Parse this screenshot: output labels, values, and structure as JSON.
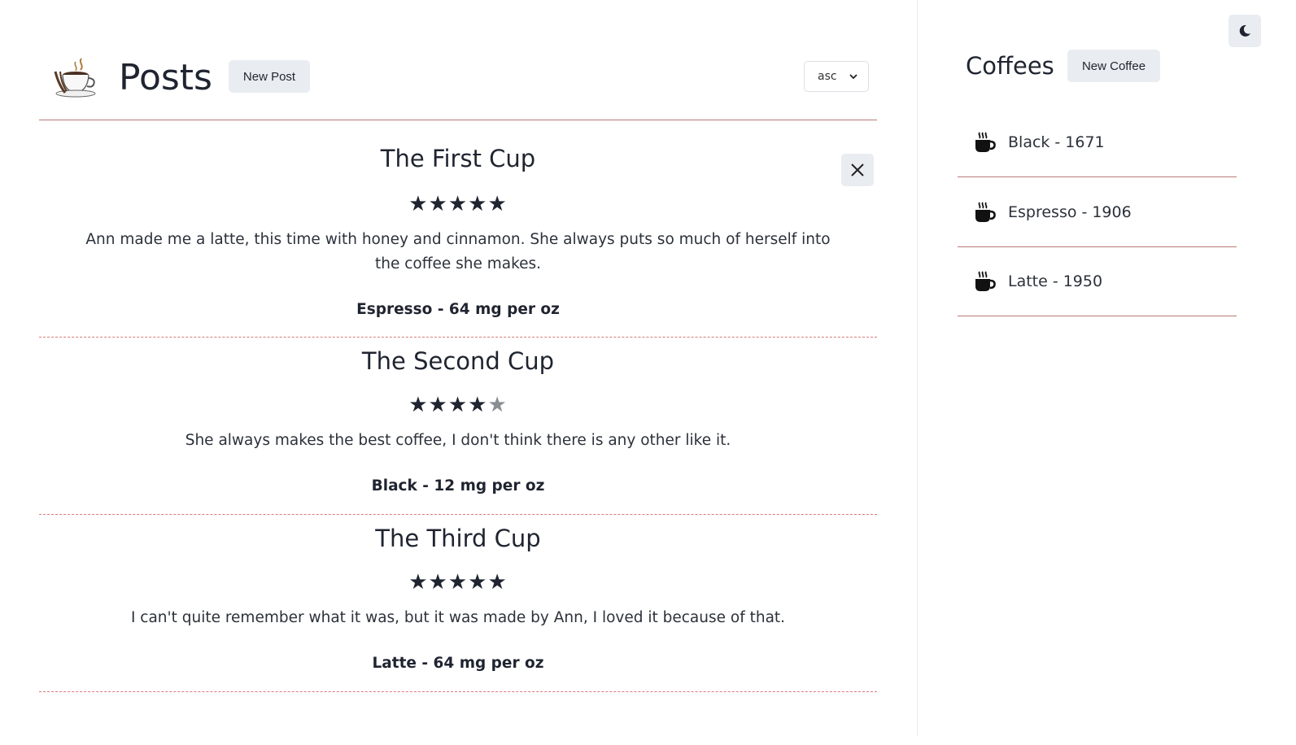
{
  "posts_panel": {
    "title": "Posts",
    "new_post_label": "New Post",
    "sort": {
      "selected": "asc"
    }
  },
  "posts": [
    {
      "title": "The First Cup",
      "rating": 5,
      "body": "Ann made me a latte, this time with honey and cinnamon. She always puts so much of herself into the coffee she makes.",
      "coffee": "Espresso - 64 mg per oz"
    },
    {
      "title": "The Second Cup",
      "rating": 4,
      "body": "She always makes the best coffee, I don't think there is any other like it.",
      "coffee": "Black - 12 mg per oz"
    },
    {
      "title": "The Third Cup",
      "rating": 5,
      "body": "I can't quite remember what it was, but it was made by Ann, I loved it because of that.",
      "coffee": "Latte - 64 mg per oz"
    }
  ],
  "coffees_panel": {
    "title": "Coffees",
    "new_coffee_label": "New Coffee",
    "separator": "-",
    "items": [
      {
        "name": "Black",
        "year": "1671"
      },
      {
        "name": "Espresso",
        "year": "1906"
      },
      {
        "name": "Latte",
        "year": "1950"
      }
    ]
  },
  "icons": {
    "logo": "coffee-cup-logo-icon",
    "close": "close-icon",
    "chevron": "chevron-down-icon",
    "coffee_item": "mug-hot-icon",
    "theme": "moon-icon"
  },
  "colors": {
    "accent_line": "#b77a76",
    "dashed_line": "#d97b7b",
    "button_bg": "#e9edf1",
    "text": "#1f2430"
  }
}
